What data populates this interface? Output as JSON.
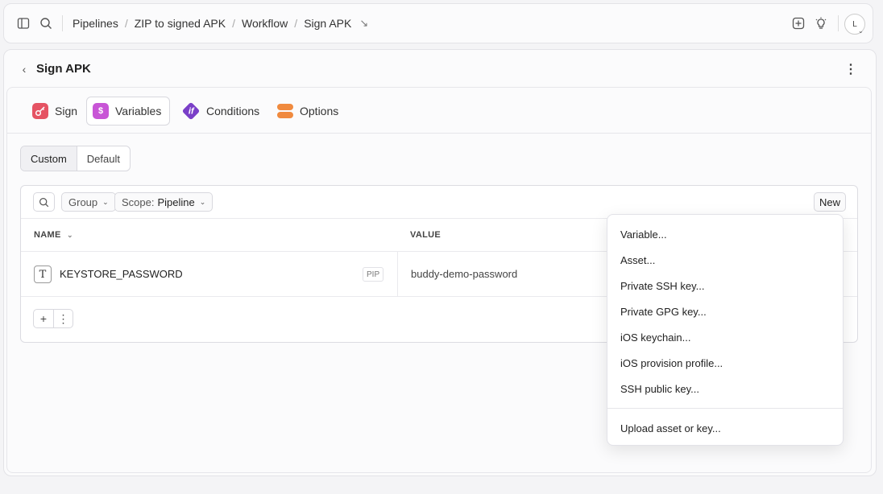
{
  "topbar": {
    "breadcrumb": [
      "Pipelines",
      "ZIP to signed APK",
      "Workflow",
      "Sign APK"
    ],
    "avatar_initial": "L"
  },
  "page": {
    "title": "Sign APK"
  },
  "tabs": [
    {
      "label": "Sign",
      "icon": "key-icon",
      "color": "#e55363"
    },
    {
      "label": "Variables",
      "icon": "dollar-icon",
      "color": "#c855d6",
      "active": true
    },
    {
      "label": "Conditions",
      "icon": "if-icon",
      "color": "#7a3fc8"
    },
    {
      "label": "Options",
      "icon": "toggles-icon",
      "color": "#f08a3e"
    }
  ],
  "segment": {
    "custom": "Custom",
    "default": "Default"
  },
  "toolbar": {
    "group_label": "Group",
    "scope_prefix": "Scope:",
    "scope_value": "Pipeline",
    "new_label": "New"
  },
  "table": {
    "columns": [
      "NAME",
      "VALUE"
    ],
    "rows": [
      {
        "name": "KEYSTORE_PASSWORD",
        "badge": "PIP",
        "value": "buddy-demo-password"
      }
    ]
  },
  "menu": {
    "items": [
      "Variable...",
      "Asset...",
      "Private SSH key...",
      "Private GPG key...",
      "iOS keychain...",
      "iOS provision profile...",
      "SSH public key..."
    ],
    "upload": "Upload asset or key..."
  }
}
